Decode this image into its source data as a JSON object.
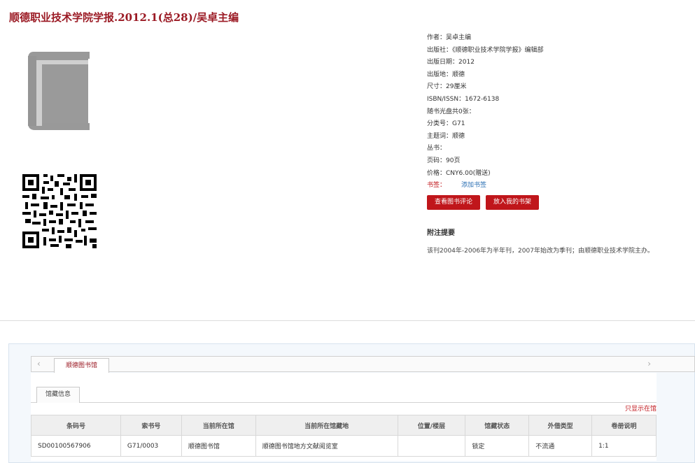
{
  "title": "顺德职业技术学院学报.2012.1(总28)/吴卓主编",
  "meta": [
    {
      "label": "作者：",
      "value": "吴卓主编"
    },
    {
      "label": "出版社：",
      "value": "《顺德职业技术学院学报》编辑部"
    },
    {
      "label": "出版日期：",
      "value": "2012"
    },
    {
      "label": "出版地：",
      "value": "顺德"
    },
    {
      "label": "尺寸：",
      "value": "29厘米"
    },
    {
      "label": "ISBN/ISSN：",
      "value": "1672-6138"
    },
    {
      "label": "随书光盘共0张：",
      "value": ""
    },
    {
      "label": "分类号：",
      "value": "G71"
    },
    {
      "label": "主题词：",
      "value": "顺德"
    },
    {
      "label": "丛书：",
      "value": ""
    },
    {
      "label": "页码：",
      "value": "90页"
    },
    {
      "label": "价格：",
      "value": "CNY6.00(赠送)"
    }
  ],
  "bookmark": {
    "label": "书签：",
    "link": "添加书签"
  },
  "buttons": {
    "review": "查看图书评论",
    "shelf": "放入我的书架"
  },
  "notes": {
    "heading": "附注提要",
    "text": "该刊2004年-2006年为半年刊，2007年始改为季刊；由顺德职业技术学院主办。"
  },
  "library_tab": "顺德图书馆",
  "sub_tab": "馆藏信息",
  "only_show_link": "只显示在馆",
  "table": {
    "headers": [
      "条码号",
      "索书号",
      "当前所在馆",
      "当前所在馆藏地",
      "位置/楼层",
      "馆藏状态",
      "外借类型",
      "卷册说明"
    ],
    "rows": [
      [
        "SD00100567906",
        "G71/0003",
        "顺德图书馆",
        "顺德图书馆地方文献阅览室",
        "",
        "锁定",
        "不流通",
        "1:1"
      ]
    ]
  },
  "colors": {
    "accent": "#c0161b",
    "title": "#9b1a24",
    "link": "#2a6fb3"
  },
  "icons": [
    "book-icon",
    "qr-code",
    "chevron-left-icon",
    "chevron-right-icon"
  ]
}
